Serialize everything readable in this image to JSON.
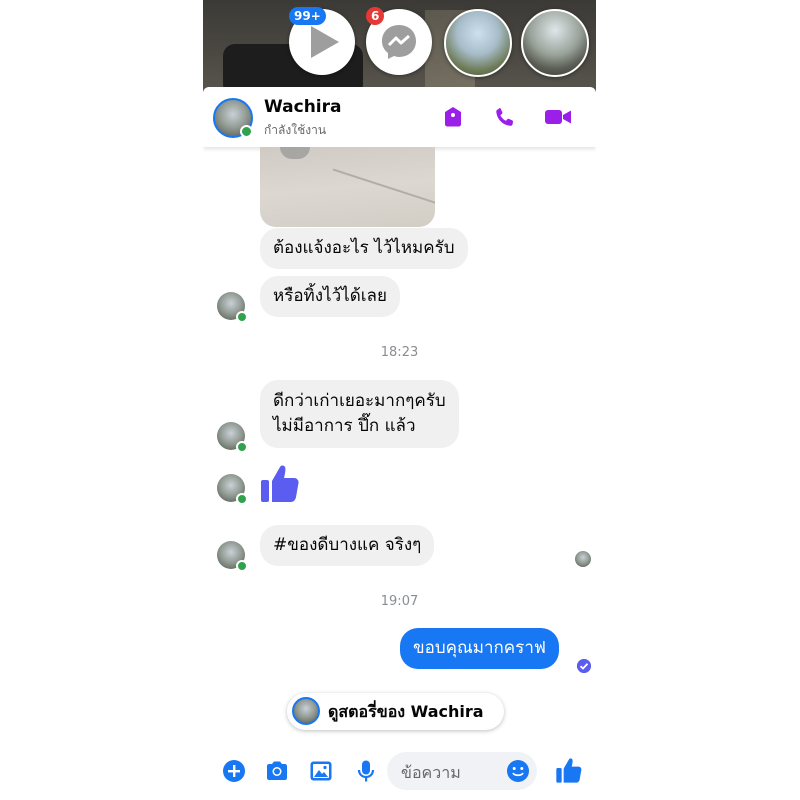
{
  "chat_heads": {
    "badge_play": "99+",
    "badge_messenger": "6"
  },
  "header": {
    "contact_name": "Wachira",
    "status": "กำลังใช้งาน"
  },
  "messages": {
    "m1": "ต้องแจ้งอะไร ไว้ไหมครับ",
    "m2": "หรือทิ้งไว้ได้เลย",
    "time1": "18:23",
    "m3_line1": "ดีกว่าเก่าเยอะมากๆครับ",
    "m3_line2": "ไม่มีอาการ ปึ๊ก แล้ว",
    "m4": "#ของดีบางแค จริงๆ",
    "time2": "19:07",
    "m5": "ขอบคุณมากคราฟ"
  },
  "story_button": {
    "label": "ดูสตอรี่ของ Wachira"
  },
  "composer": {
    "placeholder": "ข้อความ"
  },
  "colors": {
    "accent": "#1877f2",
    "like": "#5b5cf0",
    "online": "#31a24c",
    "header_icon": "#9b1fe8"
  },
  "icons": [
    "play-icon",
    "messenger-icon",
    "shield-icon",
    "phone-icon",
    "video-icon",
    "like-icon",
    "plus-icon",
    "camera-icon",
    "gallery-icon",
    "mic-icon",
    "emoji-icon"
  ]
}
